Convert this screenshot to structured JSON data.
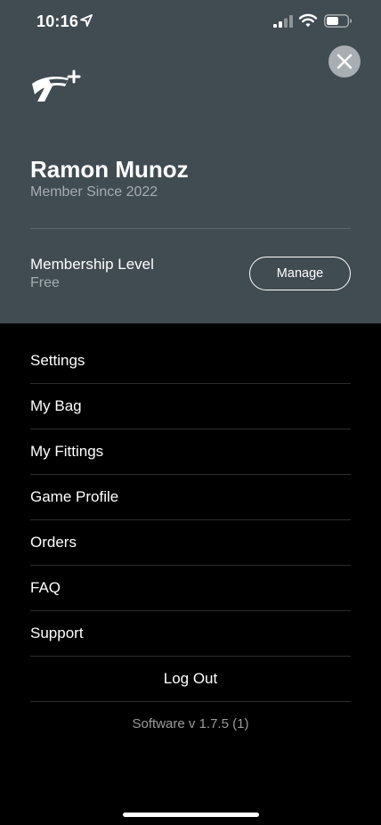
{
  "status_bar": {
    "time": "10:16",
    "icons": [
      "location-arrow-icon",
      "cellular-signal-icon",
      "wifi-icon",
      "battery-icon"
    ]
  },
  "header": {
    "close_icon": "close-icon",
    "logo_icon": "taylormade-plus-logo",
    "user_name": "Ramon Munoz",
    "member_since": "Member Since 2022",
    "membership_label": "Membership Level",
    "membership_value": "Free",
    "manage_label": "Manage"
  },
  "menu": {
    "items": [
      {
        "label": "Settings"
      },
      {
        "label": "My Bag"
      },
      {
        "label": "My Fittings"
      },
      {
        "label": "Game Profile"
      },
      {
        "label": "Orders"
      },
      {
        "label": "FAQ"
      },
      {
        "label": "Support"
      }
    ],
    "logout_label": "Log Out"
  },
  "footer": {
    "software_version": "Software v 1.7.5 (1)"
  },
  "colors": {
    "header_background": "#414b52",
    "page_background": "#000000",
    "secondary_text": "#a5acb1",
    "close_button": "#a9aeb2"
  }
}
